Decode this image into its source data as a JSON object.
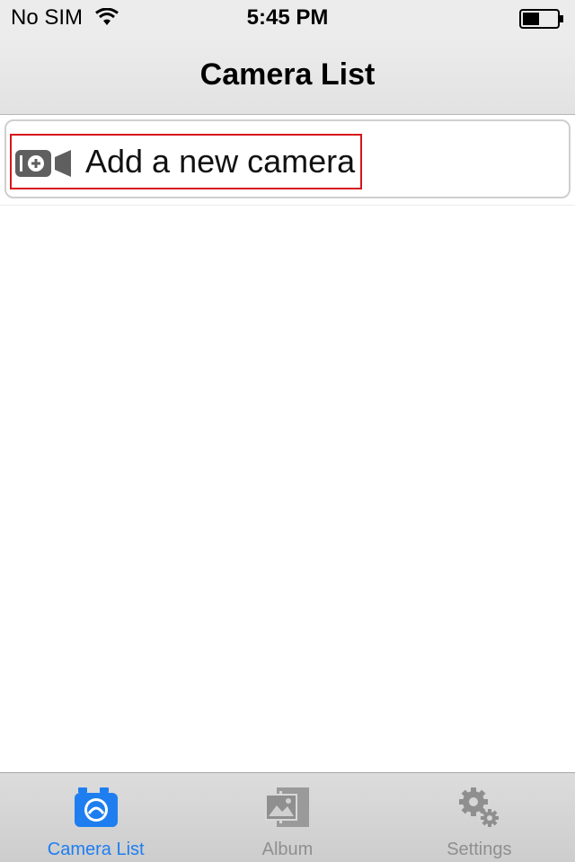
{
  "status_bar": {
    "carrier": "No SIM",
    "time": "5:45 PM",
    "wifi_icon": "wifi-icon",
    "battery_icon": "battery-icon"
  },
  "nav": {
    "title": "Camera List"
  },
  "list": {
    "add_camera_label": "Add a new camera",
    "add_camera_icon": "camera-add-icon"
  },
  "tab_bar": {
    "tabs": [
      {
        "label": "Camera List",
        "icon": "camera-icon",
        "selected": true
      },
      {
        "label": "Album",
        "icon": "album-icon",
        "selected": false
      },
      {
        "label": "Settings",
        "icon": "gear-icon",
        "selected": false
      }
    ]
  },
  "colors": {
    "accent": "#1e7ef0",
    "inactive": "#8f8f8f",
    "highlight": "#d7141a"
  }
}
